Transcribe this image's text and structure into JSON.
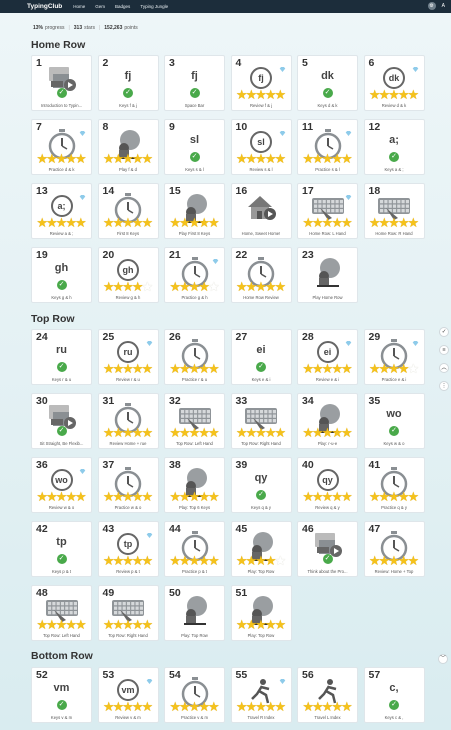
{
  "topbar": {
    "brand": "TypingClub",
    "nav": [
      "Home",
      "Gem",
      "Badges",
      "Typing Jungle"
    ],
    "icons": [
      "settings-icon",
      "user-icon"
    ]
  },
  "stats": {
    "progress_value": "13%",
    "progress_label": "progress",
    "stars_value": "313",
    "stars_label": "stars",
    "points_value": "152,263",
    "points_label": "points"
  },
  "sections": [
    {
      "title": "Home Row",
      "lessons": [
        {
          "num": "1",
          "caption": "Introduction to Typin...",
          "icon": "video",
          "done": true,
          "stars": 0,
          "gem": false
        },
        {
          "num": "2",
          "caption": "Keys f & j",
          "icon": "key",
          "glyph": "fj",
          "done": true,
          "stars": 0,
          "gem": false
        },
        {
          "num": "3",
          "caption": "Space Bar",
          "icon": "key",
          "glyph": "fj",
          "done": true,
          "stars": 0,
          "gem": false
        },
        {
          "num": "4",
          "caption": "Review f & j",
          "icon": "key-circle",
          "glyph": "fj",
          "done": false,
          "stars": 5,
          "gem": true
        },
        {
          "num": "5",
          "caption": "Keys d & k",
          "icon": "key",
          "glyph": "dk",
          "done": true,
          "stars": 0,
          "gem": false
        },
        {
          "num": "6",
          "caption": "Review d & k",
          "icon": "key-circle",
          "glyph": "dk",
          "done": false,
          "stars": 5,
          "gem": true
        },
        {
          "num": "7",
          "caption": "Practice d & k",
          "icon": "timer",
          "done": false,
          "stars": 5,
          "gem": true
        },
        {
          "num": "8",
          "caption": "Play f & d",
          "icon": "game",
          "done": false,
          "stars": 5,
          "gem": false
        },
        {
          "num": "9",
          "caption": "Keys s & l",
          "icon": "key",
          "glyph": "sl",
          "done": true,
          "stars": 0,
          "gem": false
        },
        {
          "num": "10",
          "caption": "Review s & l",
          "icon": "key-circle",
          "glyph": "sl",
          "done": false,
          "stars": 5,
          "gem": true
        },
        {
          "num": "11",
          "caption": "Practice s & l",
          "icon": "timer",
          "done": false,
          "stars": 5,
          "gem": true
        },
        {
          "num": "12",
          "caption": "Keys a & ;",
          "icon": "key",
          "glyph": "a;",
          "done": true,
          "stars": 0,
          "gem": false
        },
        {
          "num": "13",
          "caption": "Review a & ;",
          "icon": "key-circle",
          "glyph": "a;",
          "done": false,
          "stars": 5,
          "gem": true
        },
        {
          "num": "14",
          "caption": "First 8 Keys",
          "icon": "timer",
          "done": false,
          "stars": 5,
          "gem": false
        },
        {
          "num": "15",
          "caption": "Play First 8 Keys",
          "icon": "game",
          "done": false,
          "stars": 5,
          "gem": false
        },
        {
          "num": "16",
          "caption": "Home, Sweet Home!",
          "icon": "house",
          "done": false,
          "stars": 0,
          "gem": false
        },
        {
          "num": "17",
          "caption": "Home Row: L Hand",
          "icon": "keyboard",
          "done": false,
          "stars": 5,
          "gem": true
        },
        {
          "num": "18",
          "caption": "Home Row: R Hand",
          "icon": "keyboard",
          "done": false,
          "stars": 5,
          "gem": false
        },
        {
          "num": "19",
          "caption": "Keys g & h",
          "icon": "key",
          "glyph": "gh",
          "done": true,
          "stars": 0,
          "gem": false
        },
        {
          "num": "20",
          "caption": "Review g & h",
          "icon": "key-circle",
          "glyph": "gh",
          "done": false,
          "stars": 4,
          "gem": false
        },
        {
          "num": "21",
          "caption": "Practice g & h",
          "icon": "timer",
          "done": false,
          "stars": 4,
          "gem": true
        },
        {
          "num": "22",
          "caption": "Home Row Review",
          "icon": "timer",
          "done": false,
          "stars": 5,
          "gem": false
        },
        {
          "num": "23",
          "caption": "Play Home Row",
          "icon": "game",
          "done": false,
          "stars": 0,
          "gem": false
        }
      ]
    },
    {
      "title": "Top Row",
      "lessons": [
        {
          "num": "24",
          "caption": "Keys r & u",
          "icon": "key",
          "glyph": "ru",
          "done": true,
          "stars": 0,
          "gem": false
        },
        {
          "num": "25",
          "caption": "Review r & u",
          "icon": "key-circle",
          "glyph": "ru",
          "done": false,
          "stars": 5,
          "gem": true
        },
        {
          "num": "26",
          "caption": "Practice r & u",
          "icon": "timer",
          "done": false,
          "stars": 5,
          "gem": false
        },
        {
          "num": "27",
          "caption": "Keys e & i",
          "icon": "key",
          "glyph": "ei",
          "done": true,
          "stars": 0,
          "gem": false
        },
        {
          "num": "28",
          "caption": "Review e & i",
          "icon": "key-circle",
          "glyph": "ei",
          "done": false,
          "stars": 5,
          "gem": true
        },
        {
          "num": "29",
          "caption": "Practice e & i",
          "icon": "timer",
          "done": false,
          "stars": 4,
          "gem": true
        },
        {
          "num": "30",
          "caption": "Sit Straight, Be Flexib...",
          "icon": "video",
          "done": true,
          "stars": 0,
          "gem": false
        },
        {
          "num": "31",
          "caption": "Review Home + rue",
          "icon": "timer",
          "done": false,
          "stars": 5,
          "gem": false
        },
        {
          "num": "32",
          "caption": "Top Row: Left Hand",
          "icon": "keyboard",
          "done": false,
          "stars": 5,
          "gem": false
        },
        {
          "num": "33",
          "caption": "Top Row: Right Hand",
          "icon": "keyboard",
          "done": false,
          "stars": 5,
          "gem": false
        },
        {
          "num": "34",
          "caption": "Play: r-u-e",
          "icon": "game",
          "done": false,
          "stars": 5,
          "gem": false
        },
        {
          "num": "35",
          "caption": "Keys w & o",
          "icon": "key",
          "glyph": "wo",
          "done": true,
          "stars": 0,
          "gem": false
        },
        {
          "num": "36",
          "caption": "Review w & o",
          "icon": "key-circle",
          "glyph": "wo",
          "done": false,
          "stars": 5,
          "gem": true
        },
        {
          "num": "37",
          "caption": "Practice w & o",
          "icon": "timer",
          "done": false,
          "stars": 5,
          "gem": false
        },
        {
          "num": "38",
          "caption": "Play: Top 6 Keys",
          "icon": "game",
          "done": false,
          "stars": 5,
          "gem": false
        },
        {
          "num": "39",
          "caption": "Keys q & y",
          "icon": "key",
          "glyph": "qy",
          "done": true,
          "stars": 0,
          "gem": false
        },
        {
          "num": "40",
          "caption": "Review q & y",
          "icon": "key-circle",
          "glyph": "qy",
          "done": false,
          "stars": 5,
          "gem": false
        },
        {
          "num": "41",
          "caption": "Practice q & y",
          "icon": "timer",
          "done": false,
          "stars": 5,
          "gem": false
        },
        {
          "num": "42",
          "caption": "Keys p & t",
          "icon": "key",
          "glyph": "tp",
          "done": true,
          "stars": 0,
          "gem": false
        },
        {
          "num": "43",
          "caption": "Review p & t",
          "icon": "key-circle",
          "glyph": "tp",
          "done": false,
          "stars": 5,
          "gem": true
        },
        {
          "num": "44",
          "caption": "Practice p & t",
          "icon": "timer",
          "done": false,
          "stars": 5,
          "gem": false
        },
        {
          "num": "45",
          "caption": "Play: Top Row",
          "icon": "game",
          "done": false,
          "stars": 4,
          "gem": false
        },
        {
          "num": "46",
          "caption": "Think about the Pro...",
          "icon": "video",
          "done": true,
          "stars": 0,
          "gem": false
        },
        {
          "num": "47",
          "caption": "Review: Home + Top",
          "icon": "timer",
          "done": false,
          "stars": 5,
          "gem": false
        },
        {
          "num": "48",
          "caption": "Top Row: Left Hand",
          "icon": "keyboard",
          "done": false,
          "stars": 5,
          "gem": false
        },
        {
          "num": "49",
          "caption": "Top Row: Right Hand",
          "icon": "keyboard",
          "done": false,
          "stars": 5,
          "gem": false
        },
        {
          "num": "50",
          "caption": "Play: Top Row",
          "icon": "game",
          "done": false,
          "stars": 0,
          "gem": false
        },
        {
          "num": "51",
          "caption": "Play: Top Row",
          "icon": "game",
          "done": false,
          "stars": 5,
          "gem": false
        }
      ]
    },
    {
      "title": "Bottom Row",
      "lessons": [
        {
          "num": "52",
          "caption": "Keys v & m",
          "icon": "key",
          "glyph": "vm",
          "done": true,
          "stars": 0,
          "gem": false
        },
        {
          "num": "53",
          "caption": "Review v & m",
          "icon": "key-circle",
          "glyph": "vm",
          "done": false,
          "stars": 5,
          "gem": true
        },
        {
          "num": "54",
          "caption": "Practice v & m",
          "icon": "timer",
          "done": false,
          "stars": 5,
          "gem": false
        },
        {
          "num": "55",
          "caption": "Travel R Index",
          "icon": "runner",
          "done": false,
          "stars": 5,
          "gem": true
        },
        {
          "num": "56",
          "caption": "Travel L Index",
          "icon": "runner",
          "done": false,
          "stars": 5,
          "gem": false
        },
        {
          "num": "57",
          "caption": "Keys c & ,",
          "icon": "key",
          "glyph": "c,",
          "done": true,
          "stars": 0,
          "gem": false
        }
      ]
    }
  ],
  "colors": {
    "topbar": "#1c2d3b",
    "check": "#49a94a",
    "star": "#f5c21b",
    "gem": "#8ecbea"
  }
}
